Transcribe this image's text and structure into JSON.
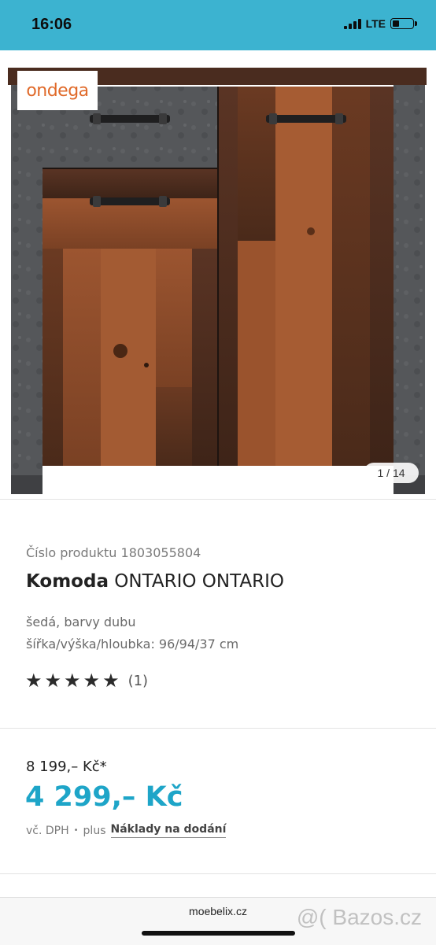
{
  "status_bar": {
    "time": "16:06",
    "network": "LTE",
    "battery_level": 0.35
  },
  "gallery": {
    "logo_text": "ondega",
    "counter": "1 / 14"
  },
  "product": {
    "number_label": "Číslo produktu 1803055804",
    "title_bold": "Komoda",
    "title_rest": " ONTARIO ONTARIO",
    "color": "šedá, barvy dubu",
    "dimensions": "šířka/výška/hloubka: 96/94/37 cm",
    "rating_stars": 5,
    "rating_count": "(1)"
  },
  "pricing": {
    "old_price": "8 199,– Kč*",
    "new_price": "4 299,– Kč",
    "vat_note": "vč. DPH",
    "plus_label": "plus",
    "delivery_link": "Náklady na dodání"
  },
  "browser": {
    "url": "moebelix.cz",
    "watermark": "@( Bazos.cz"
  },
  "colors": {
    "accent": "#1ea5c8",
    "status_bar": "#3cb3d0",
    "logo": "#e06a2a"
  }
}
